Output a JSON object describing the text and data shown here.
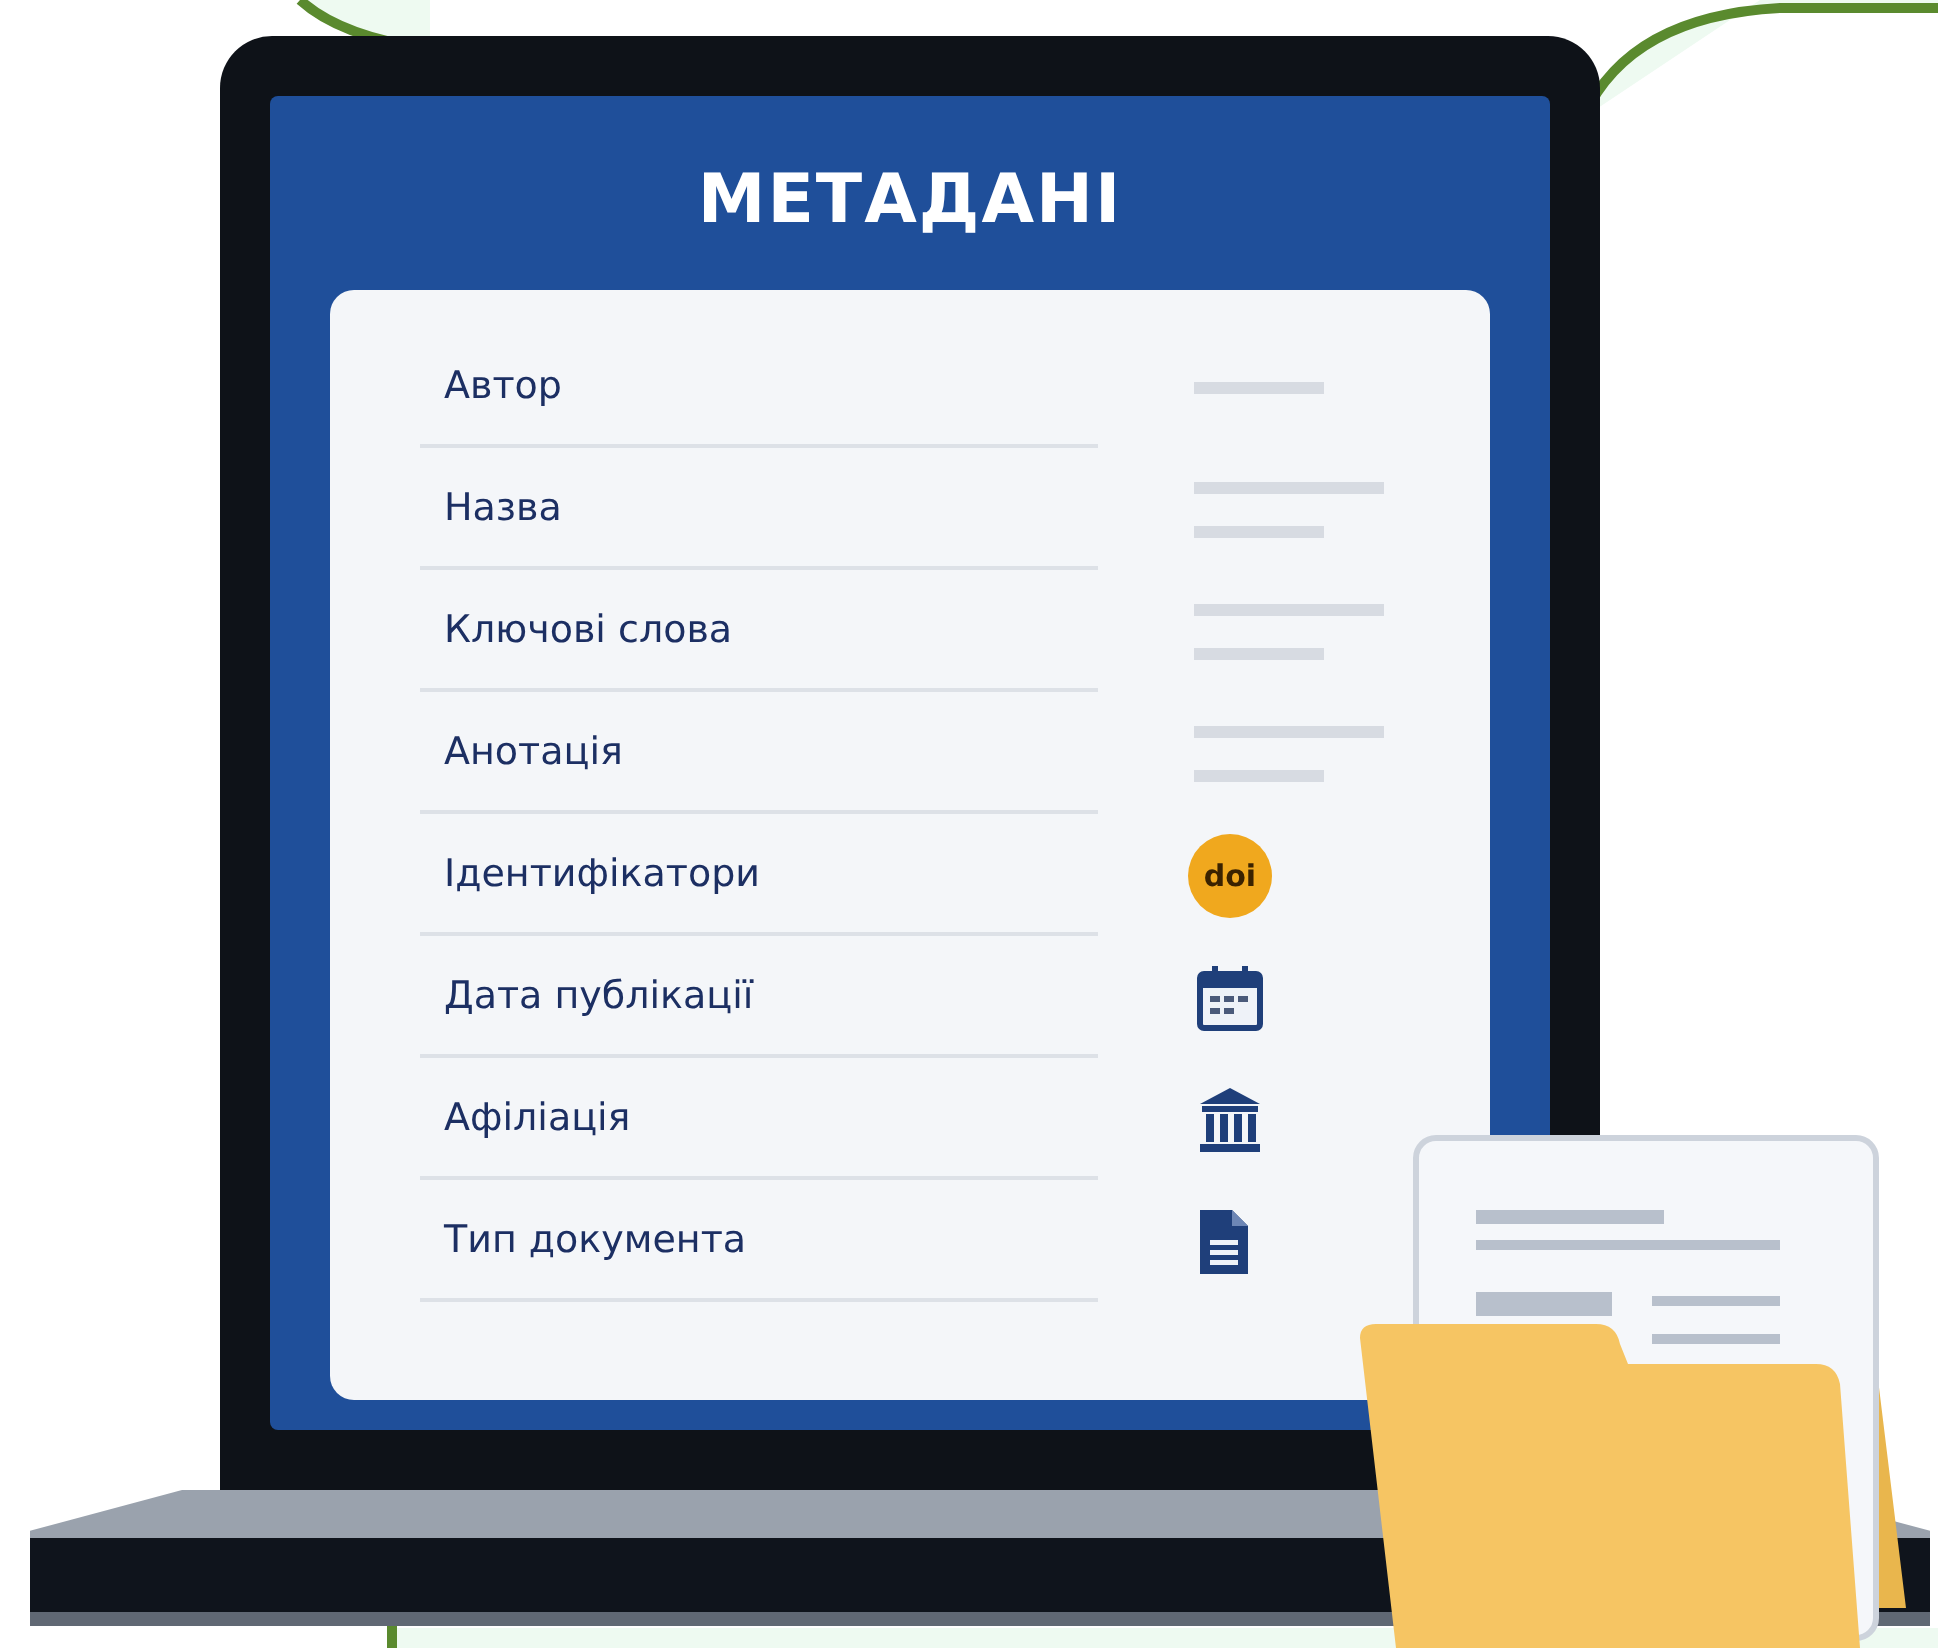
{
  "screen": {
    "title": "МЕТАДАНІ",
    "rows": [
      {
        "label": "Автор",
        "kind": "single-line"
      },
      {
        "label": "Назва",
        "kind": "double-line"
      },
      {
        "label": "Ключові слова",
        "kind": "double-line"
      },
      {
        "label": "Анотація",
        "kind": "double-line"
      },
      {
        "label": "Ідентифікатори",
        "kind": "doi",
        "badge": "doi"
      },
      {
        "label": "Дата публікації",
        "kind": "calendar"
      },
      {
        "label": "Афіліація",
        "kind": "building"
      },
      {
        "label": "Тип документа",
        "kind": "document"
      }
    ]
  }
}
